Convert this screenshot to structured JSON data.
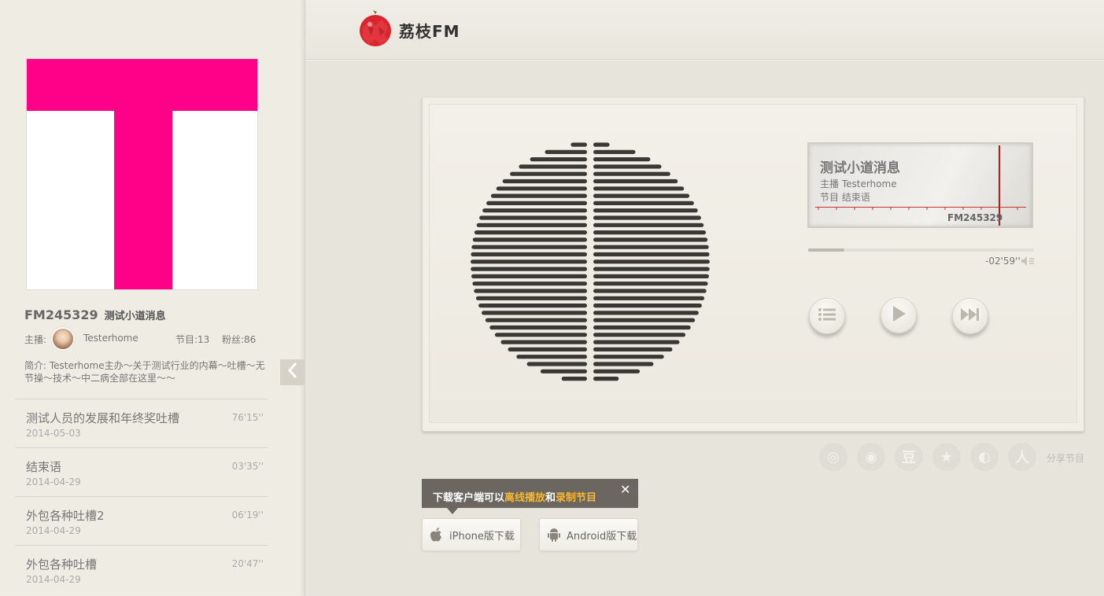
{
  "channel": {
    "fm_number": "FM245329",
    "name": "测试小道消息",
    "host_label": "主播:",
    "host_name": "Testerhome",
    "programs_label": "节目:13",
    "fans_label": "粉丝:86",
    "intro": "简介: Testerhome主办～关于测试行业的内幕～吐槽～无节操～技术～中二病全部在这里～～"
  },
  "episodes": [
    {
      "title": "测试人员的发展和年终奖吐槽",
      "date": "2014-05-03",
      "duration": "76'15''"
    },
    {
      "title": "结束语",
      "date": "2014-04-29",
      "duration": "03'35''"
    },
    {
      "title": "外包各种吐槽2",
      "date": "2014-04-29",
      "duration": "06'19''"
    },
    {
      "title": "外包各种吐槽",
      "date": "2014-04-29",
      "duration": "20'47''"
    }
  ],
  "header": {
    "logo_text": "荔枝FM"
  },
  "player": {
    "display_title": "测试小道消息",
    "display_host": "主播 Testerhome",
    "display_program": "节目 结束语",
    "display_fm": "FM245329",
    "time_remaining": "-02'59''",
    "progress": 0.16
  },
  "share": {
    "label": "分享节目",
    "icons": [
      "aperture-icon",
      "weibo-icon",
      "douban-icon",
      "star-icon",
      "qzone-icon",
      "renren-icon"
    ]
  },
  "download": {
    "tip_prefix": "下载客户端可以",
    "tip_offline": "离线播放",
    "tip_and": "和",
    "tip_record": "录制节目",
    "iphone_label": "iPhone版下载",
    "android_label": "Android版下载"
  },
  "colors": {
    "cover_pink": "#ff0088",
    "accent_red": "#b81c1c",
    "highlight": "#f7b733"
  }
}
